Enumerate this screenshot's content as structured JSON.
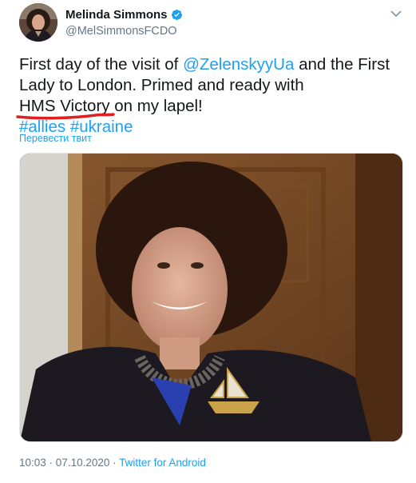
{
  "user": {
    "display_name": "Melinda Simmons",
    "handle": "@MelSimmonsFCDO",
    "avatar_icon": "profile-photo",
    "verified_icon": "verified-badge-icon"
  },
  "tweet": {
    "text_part1": "First day of the visit of ",
    "mention": "@ZelenskyyUa",
    "text_part2": " and the First Lady to London. Primed and ready with ",
    "highlight": "HMS Victory on",
    "text_part3": " my lapel!",
    "hashtag1": "#allies",
    "hashtag2": "#ukraine",
    "translate_label": "Перевести твит"
  },
  "media": {
    "icon": "photo-of-woman-with-ship-brooch"
  },
  "meta": {
    "time": "10:03",
    "separator": " · ",
    "date": "07.10.2020",
    "source": "Twitter for Android"
  },
  "colors": {
    "link": "#1da1f2",
    "secondary": "#657786",
    "annotation_underline": "#e02020"
  }
}
